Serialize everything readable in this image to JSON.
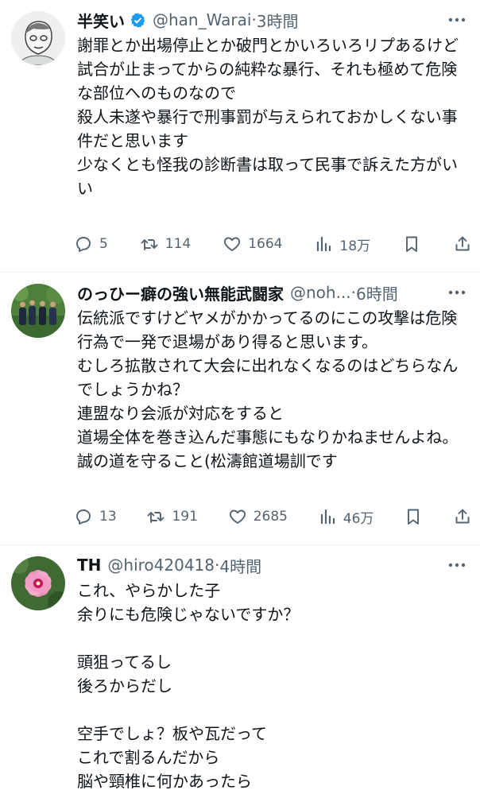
{
  "tweets": [
    {
      "name": "半笑い",
      "handle": "@han_Warai",
      "dot": "·",
      "time": "3時間",
      "text": "謝罪とか出場停止とか破門とかいろいろリプあるけど\n試合が止まってからの純粋な暴行、それも極めて危険な部位へのものなので\n殺人未遂や暴行で刑事罰が与えられておかしくない事件だと思います\n少なくとも怪我の診断書は取って民事で訴えた方がいい",
      "replies": "5",
      "retweets": "114",
      "likes": "1664",
      "views": "18万",
      "verified": true
    },
    {
      "name": "のっひー癖の強い無能武闘家",
      "handle": "@noh...",
      "dot": "·",
      "time": "6時間",
      "text": "伝統派ですけどヤメがかかってるのにこの攻撃は危険行為で一発で退場があり得ると思います。\nむしろ拡散されて大会に出れなくなるのはどちらなんでしょうかね？\n連盟なり会派が対応をすると\n道場全体を巻き込んだ事態にもなりかねませんよね。\n誠の道を守ること(松濤館道場訓です",
      "replies": "13",
      "retweets": "191",
      "likes": "2685",
      "views": "46万"
    },
    {
      "name": "TH",
      "handle": "@hiro420418",
      "dot": "·",
      "time": "4時間",
      "text": "これ、やらかした子\n余りにも危険じゃないですか？\n\n頭狙ってるし\n後ろからだし\n\n空手でしょ？板や瓦だって\nこれで割るんだから\n脳や頸椎に何かあったら"
    }
  ],
  "colors": {
    "accent": "#1d9bf0",
    "muted": "#536471",
    "divider": "#eff3f4"
  }
}
